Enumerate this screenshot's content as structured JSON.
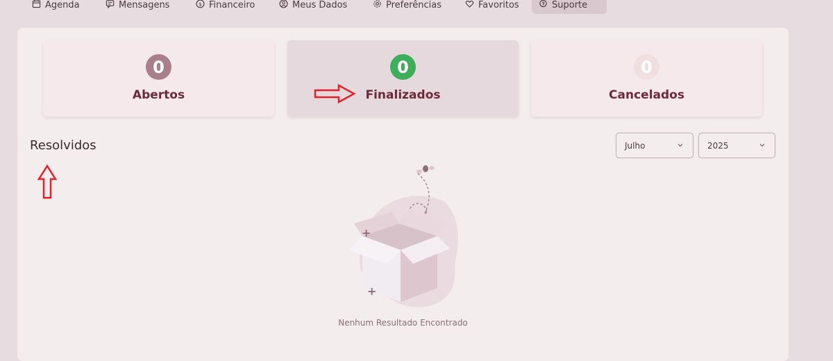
{
  "nav": {
    "items": [
      {
        "label": "Agenda",
        "icon": "calendar-icon"
      },
      {
        "label": "Mensagens",
        "icon": "message-icon"
      },
      {
        "label": "Financeiro",
        "icon": "dollar-icon"
      },
      {
        "label": "Meus Dados",
        "icon": "user-icon"
      },
      {
        "label": "Preferências",
        "icon": "gear-icon"
      },
      {
        "label": "Favoritos",
        "icon": "heart-icon"
      },
      {
        "label": "Suporte",
        "icon": "support-icon",
        "active": true
      }
    ]
  },
  "stats": [
    {
      "count": "0",
      "label": "Abertos",
      "color": "#a97f8d"
    },
    {
      "count": "0",
      "label": "Finalizados",
      "color": "#3fae5a"
    },
    {
      "count": "0",
      "label": "Cancelados",
      "color": "#f1dfdf"
    }
  ],
  "section": {
    "title": "Resolvidos"
  },
  "filters": {
    "month": "Julho",
    "year": "2025"
  },
  "empty": {
    "message": "Nenhum Resultado Encontrado"
  },
  "colors": {
    "accent": "#6a2a3c",
    "annotation": "#e0202a"
  }
}
